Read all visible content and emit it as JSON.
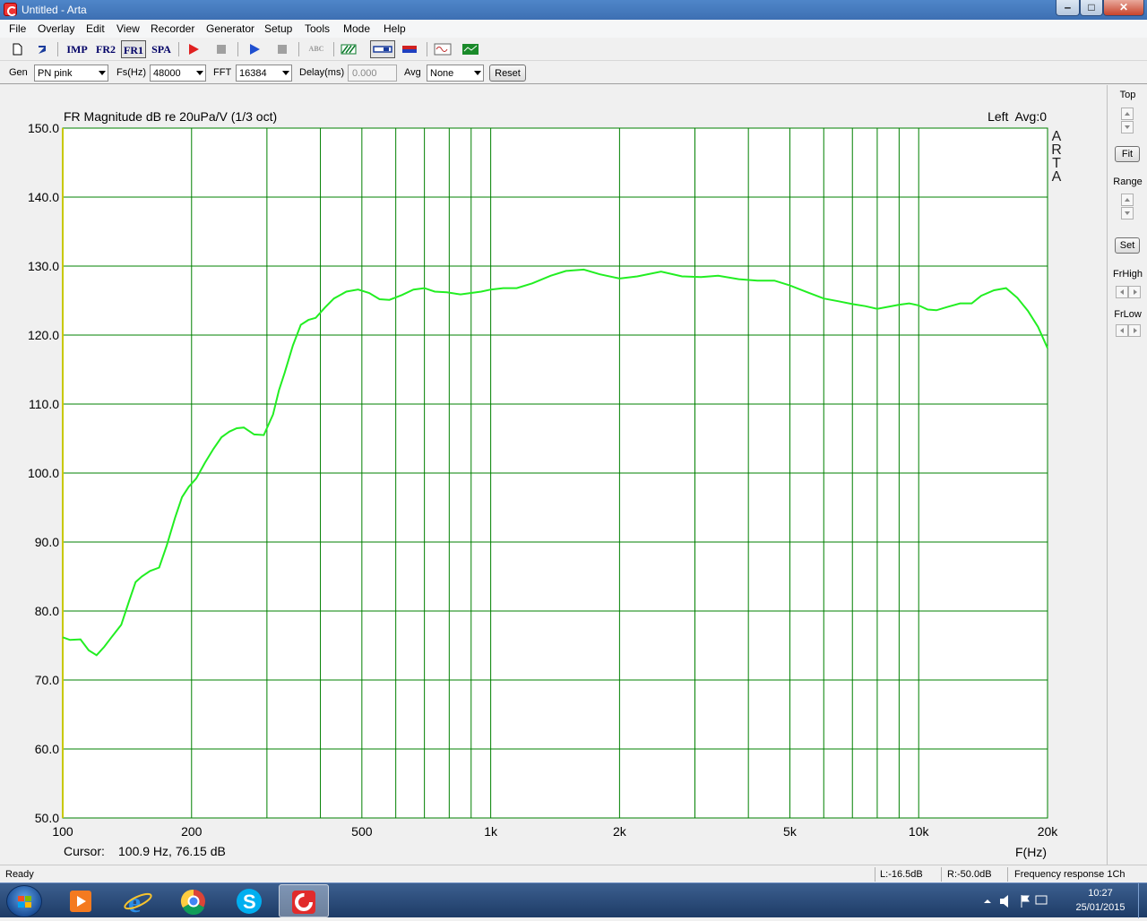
{
  "window": {
    "title": "Untitled - Arta",
    "controls": {
      "minimize": "‒",
      "maximize": "□",
      "close": "✕"
    }
  },
  "menu": [
    "File",
    "Overlay",
    "Edit",
    "View",
    "Recorder",
    "Generator",
    "Setup",
    "Tools",
    "Mode",
    "Help"
  ],
  "toolbar": {
    "imp": "IMP",
    "fr2": "FR2",
    "fr1": "FR1",
    "spa": "SPA",
    "abc": "ABC"
  },
  "settings": {
    "gen_label": "Gen",
    "gen_value": "PN pink",
    "fs_label": "Fs(Hz)",
    "fs_value": "48000",
    "fft_label": "FFT",
    "fft_value": "16384",
    "delay_label": "Delay(ms)",
    "delay_value": "0.000",
    "avg_label": "Avg",
    "avg_value": "None",
    "reset_label": "Reset"
  },
  "right_panel": {
    "top_label": "Top",
    "fit_label": "Fit",
    "range_label": "Range",
    "set_label": "Set",
    "frhigh_label": "FrHigh",
    "frlow_label": "FrLow"
  },
  "chart_data": {
    "type": "line",
    "title": "FR Magnitude dB re 20uPa/V (1/3 oct)",
    "legend_text": "Left  Avg:0",
    "watermark": "ARTA",
    "xlabel": "F(Hz)",
    "x_scale": "log",
    "xlim": [
      100,
      20000
    ],
    "ylim": [
      50,
      150
    ],
    "grid": true,
    "y_ticks": [
      "150.0",
      "140.0",
      "130.0",
      "120.0",
      "110.0",
      "100.0",
      "90.0",
      "80.0",
      "70.0",
      "60.0",
      "50.0"
    ],
    "x_tick_labels": [
      {
        "value": 100,
        "label": "100"
      },
      {
        "value": 200,
        "label": "200"
      },
      {
        "value": 500,
        "label": "500"
      },
      {
        "value": 1000,
        "label": "1k"
      },
      {
        "value": 2000,
        "label": "2k"
      },
      {
        "value": 5000,
        "label": "5k"
      },
      {
        "value": 10000,
        "label": "10k"
      },
      {
        "value": 20000,
        "label": "20k"
      }
    ],
    "x_gridlines": [
      200,
      300,
      400,
      500,
      600,
      700,
      800,
      900,
      1000,
      2000,
      3000,
      4000,
      5000,
      6000,
      7000,
      8000,
      9000,
      10000
    ],
    "cursor_label": "Cursor:",
    "cursor_text": "100.9 Hz, 76.15 dB",
    "colors": {
      "grid": "#008000",
      "trace": "#22ee22",
      "bg": "#ffffff"
    },
    "series": [
      {
        "x": [
          100,
          104,
          110,
          115,
          120,
          125,
          130,
          137,
          143,
          148,
          153,
          160,
          168,
          175,
          183,
          190,
          197,
          205,
          215,
          225,
          235,
          245,
          255,
          265,
          280,
          295,
          310,
          320,
          330,
          345,
          360,
          375,
          390,
          410,
          430,
          460,
          490,
          520,
          550,
          580,
          620,
          660,
          700,
          740,
          790,
          850,
          900,
          950,
          1000,
          1070,
          1150,
          1250,
          1380,
          1500,
          1650,
          1800,
          2000,
          2200,
          2500,
          2800,
          3100,
          3400,
          3800,
          4200,
          4600,
          5000,
          5500,
          6000,
          6500,
          7000,
          7500,
          8000,
          8500,
          9000,
          9500,
          10000,
          10500,
          11000,
          11700,
          12500,
          13300,
          14000,
          15000,
          16000,
          17000,
          18000,
          19000,
          20000
        ],
        "y": [
          76.2,
          75.8,
          75.9,
          74.3,
          73.6,
          74.8,
          76.2,
          78,
          81.5,
          84.2,
          85,
          85.8,
          86.3,
          89.5,
          93.5,
          96.5,
          98,
          99.2,
          101.5,
          103.5,
          105.2,
          106,
          106.5,
          106.6,
          105.6,
          105.5,
          108.5,
          112,
          114.5,
          118.5,
          121.5,
          122.2,
          122.5,
          124,
          125.3,
          126.3,
          126.6,
          126.1,
          125.2,
          125.1,
          125.8,
          126.6,
          126.8,
          126.3,
          126.2,
          125.9,
          126.1,
          126.3,
          126.6,
          126.8,
          126.8,
          127.5,
          128.6,
          129.3,
          129.5,
          128.8,
          128.2,
          128.5,
          129.2,
          128.5,
          128.4,
          128.6,
          128.1,
          127.9,
          127.9,
          127.2,
          126.2,
          125.3,
          124.9,
          124.5,
          124.2,
          123.8,
          124.1,
          124.4,
          124.6,
          124.3,
          123.7,
          123.6,
          124.1,
          124.6,
          124.6,
          125.7,
          126.5,
          126.8,
          125.4,
          123.5,
          121.2,
          118.1
        ]
      }
    ]
  },
  "statusbar": {
    "ready": "Ready",
    "left_level": "L:-16.5dB",
    "right_level": "R:-50.0dB",
    "mode": "Frequency response 1Ch"
  },
  "taskbar": {
    "time": "10:27",
    "date": "25/01/2015"
  }
}
